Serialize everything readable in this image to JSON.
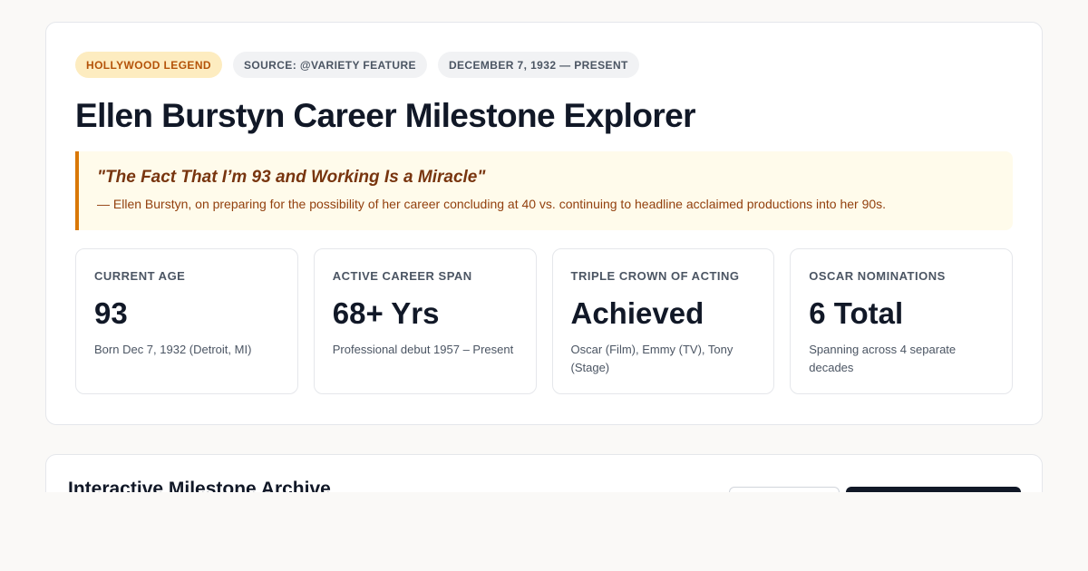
{
  "badges": {
    "legend": "HOLLYWOOD LEGEND",
    "source": "SOURCE: @VARIETY FEATURE",
    "dates": "DECEMBER 7, 1932 — PRESENT"
  },
  "title": "Ellen Burstyn Career Milestone Explorer",
  "quote": {
    "text": "\"The Fact That I’m 93 and Working Is a Miracle\"",
    "attribution": "— Ellen Burstyn, on preparing for the possibility of her career concluding at 40 vs. continuing to headline acclaimed productions into her 90s."
  },
  "stats": [
    {
      "label": "CURRENT AGE",
      "value": "93",
      "sub": "Born Dec 7, 1932 (Detroit, MI)"
    },
    {
      "label": "ACTIVE CAREER SPAN",
      "value": "68+ Yrs",
      "sub": "Professional debut 1957 – Present"
    },
    {
      "label": "TRIPLE CROWN OF ACTING",
      "value": "Achieved",
      "sub": "Oscar (Film), Emmy (TV), Tony (Stage)"
    },
    {
      "label": "OSCAR NOMINATIONS",
      "value": "6 Total",
      "sub": "Spanning across 4 separate decades"
    }
  ],
  "archive": {
    "title": "Interactive Milestone Archive"
  },
  "colors": {
    "accent": "#d97706",
    "dark": "#111827",
    "legend_badge_bg": "#fdecc0"
  }
}
